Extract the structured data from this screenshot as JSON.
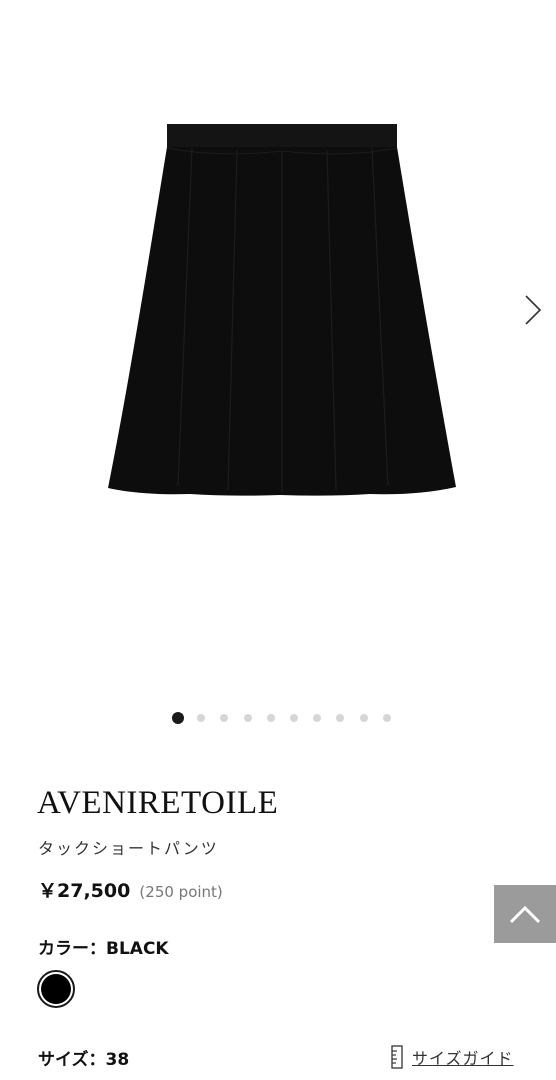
{
  "product": {
    "brand": "AVENIRETOILE",
    "name": "タックショートパンツ",
    "price": "￥27,500",
    "points": "(250 point)",
    "image_icon": "skirt-product-image"
  },
  "gallery": {
    "image_count": 10,
    "active_index": 0,
    "next_icon": "chevron-right-icon"
  },
  "color": {
    "label": "カラー：",
    "value": "BLACK",
    "swatches": [
      {
        "name": "BLACK",
        "hex": "#000000",
        "selected": true
      }
    ]
  },
  "size": {
    "label": "サイズ：",
    "value": "38",
    "guide_label": "サイズガイド",
    "guide_icon": "ruler-icon"
  },
  "scroll_top": {
    "icon": "chevron-up-icon",
    "background": "#9b9b9b"
  },
  "colors": {
    "text": "#1a1a1a",
    "dot_inactive": "#d6d6d6",
    "dot_active": "#1a1a1a"
  }
}
